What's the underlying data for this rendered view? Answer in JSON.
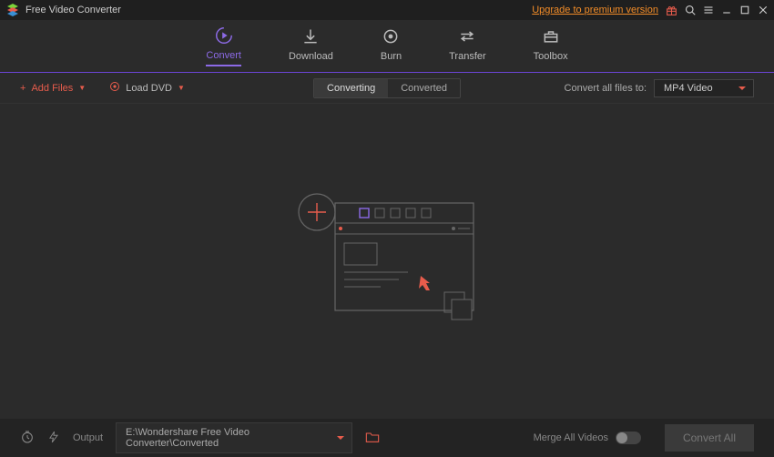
{
  "titlebar": {
    "app_name": "Free Video Converter",
    "upgrade_text": "Upgrade to premium version"
  },
  "tabs": {
    "convert": "Convert",
    "download": "Download",
    "burn": "Burn",
    "transfer": "Transfer",
    "toolbox": "Toolbox"
  },
  "subbar": {
    "add_files": "Add Files",
    "load_dvd": "Load DVD",
    "converting": "Converting",
    "converted": "Converted",
    "convert_all_files_to": "Convert all files to:",
    "format": "MP4 Video"
  },
  "footer": {
    "output_label": "Output",
    "output_path": "E:\\Wondershare Free Video Converter\\Converted",
    "merge_label": "Merge All Videos",
    "convert_all": "Convert All"
  }
}
